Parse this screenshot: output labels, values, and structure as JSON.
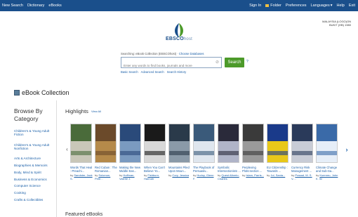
{
  "topbar": {
    "left": [
      "New Search",
      "Dictionary",
      "eBooks"
    ],
    "right": [
      "Sign In",
      "Folder",
      "Preferences",
      "Languages",
      "Help",
      "Exit"
    ],
    "chevron": "▾"
  },
  "institution": {
    "line1": "MALAYSIA (LOGO)ON",
    "line2": "BUKIT (HB) 1980"
  },
  "logo": {
    "brand": "EBSCO",
    "suffix": "host"
  },
  "search": {
    "searching_label": "Searching: eBook Collection (EBSCOhost)",
    "choose_db": "Choose Databases",
    "placeholder": "Enter any words to find books, journals and more",
    "button": "Search",
    "help": "?",
    "links": [
      "Basic Search",
      "Advanced Search",
      "Search History"
    ]
  },
  "collection_title": "eBook Collection",
  "browse": {
    "title": "Browse By Category",
    "categories": [
      "Children's & Young Adult Fiction",
      "Children's & Young Adult Nonfiction",
      "Arts & Architecture",
      "Biographies & Memoirs",
      "Body, Mind & Spirit",
      "Business & Economics",
      "Computer Science",
      "Cooking",
      "Crafts & Collectibles"
    ]
  },
  "highlights": {
    "title": "Highlights",
    "view_all": "View All"
  },
  "carousel": {
    "prev": "‹",
    "next": "›",
    "books": [
      {
        "title": "Words That Heal : Preachi...",
        "by": "by",
        "author": "Sandster, Jack S.",
        "colors": [
          "#4a6b3a",
          "#c9c7b8"
        ]
      },
      {
        "title": "Red Cuban : The Romanian...",
        "by": "by",
        "author": "Solomon, Pete...",
        "colors": [
          "#6b4a2a",
          "#b58a4a"
        ]
      },
      {
        "title": "Making the New Middle Eas...",
        "by": "by",
        "author": "Hoffman, Valerie J.",
        "colors": [
          "#2a4a7a",
          "#7a9ac0"
        ]
      },
      {
        "title": "When You Can't Believe Yo...",
        "by": "by",
        "author": "Fishburn, Hannah",
        "colors": [
          "#1a1a1a",
          "#d8d8d8"
        ]
      },
      {
        "title": "Mountains Piled Upon Moun...",
        "by": "by",
        "author": "Cory, Jessica",
        "colors": [
          "#2a3a4a",
          "#8a9aa8"
        ]
      },
      {
        "title": "The Playbook of Persuasiv...",
        "by": "by",
        "author": "Hudoy, Glenn F.",
        "colors": [
          "#3a5a7a",
          "#dfe6ee"
        ]
      },
      {
        "title": "Symbolic Intersectionism ...",
        "by": "by",
        "author": "Quest Alberto, Charles",
        "colors": [
          "#2a2a3a",
          "#b0b4c8"
        ]
      },
      {
        "title": "Perplexing Plots:section ...",
        "by": "by",
        "author": "Islam, Parris...",
        "colors": [
          "#3a3a3a",
          "#9a9a9a"
        ]
      },
      {
        "title": "EU Citizenship : Towards ...",
        "by": "by",
        "author": "Jol, Sania...",
        "colors": [
          "#1a3a8a",
          "#e8c81a"
        ]
      },
      {
        "title": "Currency Risk Management ...",
        "by": "by",
        "author": "Prasad, M. S. V....",
        "colors": [
          "#2a3a5a",
          "#c8ccd6"
        ]
      },
      {
        "title": "Climate Change and Sub-Sa...",
        "by": "by",
        "author": "Kuennru, John K. W.",
        "colors": [
          "#3a6aa8",
          "#e6eef8"
        ]
      }
    ]
  },
  "featured_title": "Featured eBooks"
}
